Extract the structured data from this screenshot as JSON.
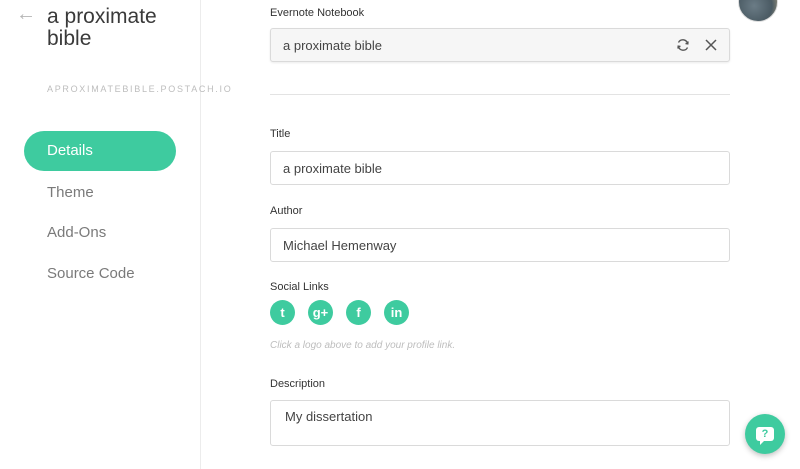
{
  "sidebar": {
    "back_glyph": "←",
    "site_title": "a proximate bible",
    "site_url": "APROXIMATEBIBLE.POSTACH.IO",
    "nav": [
      {
        "label": "Details",
        "active": true
      },
      {
        "label": "Theme",
        "active": false
      },
      {
        "label": "Add-Ons",
        "active": false
      },
      {
        "label": "Source Code",
        "active": false
      }
    ]
  },
  "form": {
    "notebook_label": "Evernote Notebook",
    "notebook_value": "a proximate bible",
    "title_label": "Title",
    "title_value": "a proximate bible",
    "author_label": "Author",
    "author_value": "Michael Hemenway",
    "social_label": "Social Links",
    "social_icons": [
      "twitter-icon",
      "google-plus-icon",
      "facebook-icon",
      "linkedin-icon"
    ],
    "social_glyphs": [
      "t",
      "g+",
      "f",
      "in"
    ],
    "social_hint": "Click a logo above to add your profile link.",
    "description_label": "Description",
    "description_value": "My dissertation"
  },
  "help_glyph": "?",
  "accent_color": "#3ecb9f"
}
